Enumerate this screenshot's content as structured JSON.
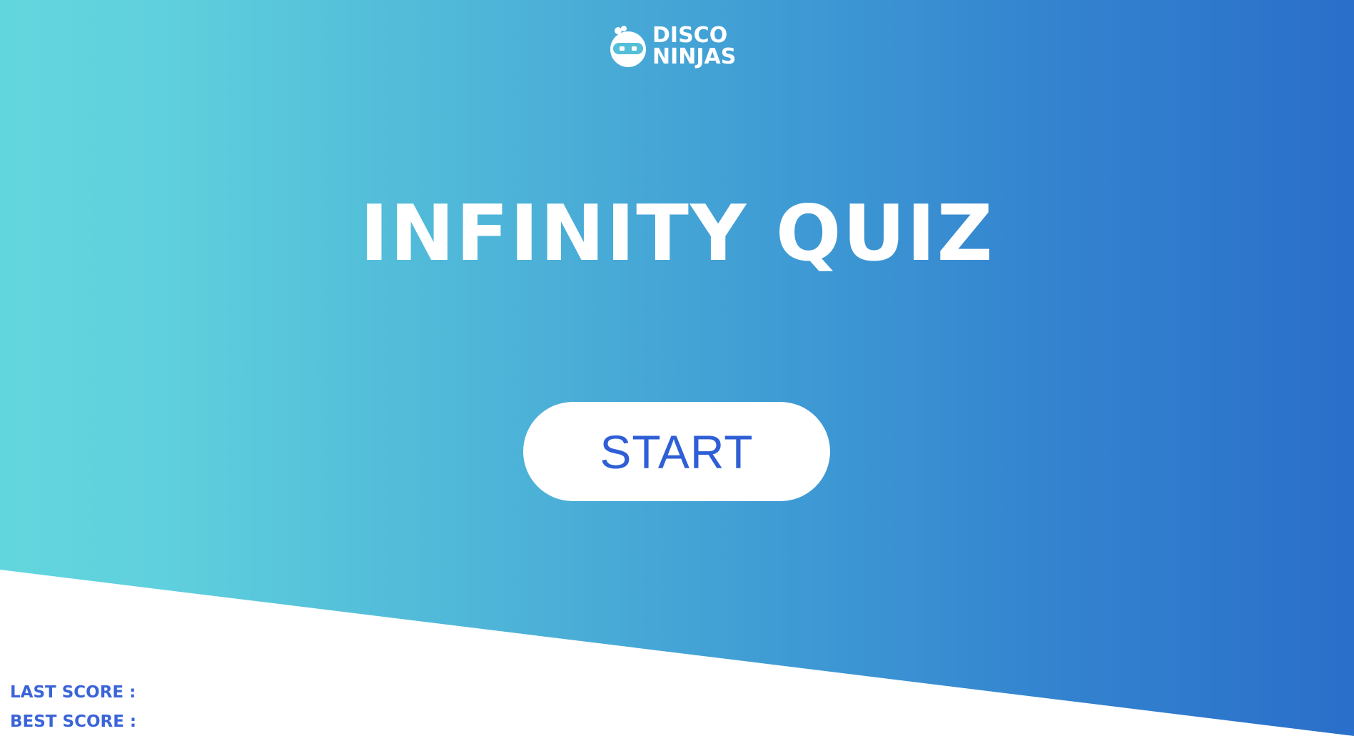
{
  "logo": {
    "line1": "DISCO",
    "line2": "NINJAS",
    "icon": "ninja-head-icon"
  },
  "title": "INFINITY QUIZ",
  "start_button": {
    "label": "START"
  },
  "scores": {
    "last_label": "LAST SCORE :",
    "best_label": "BEST SCORE :"
  },
  "colors": {
    "gradient_left": "#62d6dd",
    "gradient_right": "#2a6fca",
    "button_text": "#2f5fd6",
    "score_text": "#3a64d8"
  }
}
